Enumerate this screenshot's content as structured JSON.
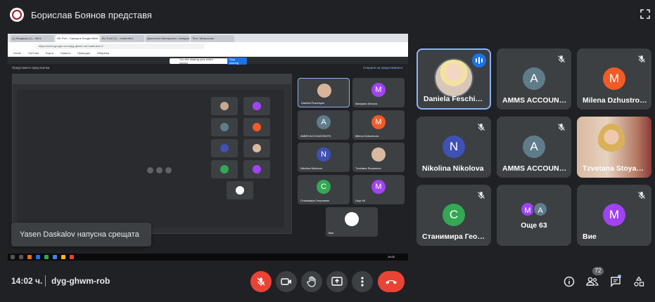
{
  "presenter": {
    "label": "Борислав Боянов представя"
  },
  "shared_screen": {
    "tabs": [
      "(1) Входящи (1) – bitrix",
      "GE Poll – Среща в Google Meet",
      "Bu.Trust (1) – email.bitrix",
      "Дигитални Материали | Instagram",
      "Тест: Шпаргалка"
    ],
    "url": "https://meet.google.com/dyg-ghwm-rob?authuser=2",
    "bookmarks": [
      "Gmail",
      "YouTube",
      "Карти",
      "Новини",
      "Преводач",
      "Wikipedia"
    ],
    "sharing_banner": "You are sharing your entire screen",
    "stop_label": "Stop sharing",
    "inner_header": "Представяте пред всички",
    "inner_header_right": "Спиране на представянето",
    "inner_tiles": [
      {
        "name": "Daniela Feschiyan",
        "initial": "",
        "color": "#d9b49a"
      },
      {
        "name": "Mariyana Dimova",
        "initial": "M",
        "color": "#a142f4"
      },
      {
        "name": "AMMS ACCOUNTANTS",
        "initial": "A",
        "color": "#5f7c8a"
      },
      {
        "name": "Milena Dzhustrova",
        "initial": "M",
        "color": "#f25a26"
      },
      {
        "name": "Nikolina Nikolova",
        "initial": "N",
        "color": "#3f51b5"
      },
      {
        "name": "Tzvetana Stoyanova",
        "initial": "",
        "color": "#d9b9a0"
      },
      {
        "name": "Станимира Георгиева",
        "initial": "C",
        "color": "#34a853"
      },
      {
        "name": "Още 64",
        "initial": "M",
        "color": "#a142f4"
      },
      {
        "name": "Вие",
        "initial": "",
        "color": "#ffffff"
      }
    ],
    "inner_btn_primary": "Спиране на представянето",
    "inner_btn_secondary": "Презентиране",
    "clock": "14:02"
  },
  "toast": {
    "text": "Yasen Daskalov напусна срещата"
  },
  "participants": [
    {
      "name": "Daniela Feschiyan",
      "initial": "",
      "color": "",
      "state": "speaking"
    },
    {
      "name": "AMMS ACCOUNTANTS",
      "initial": "A",
      "color": "#5f7c8a",
      "state": "muted"
    },
    {
      "name": "Milena Dzhustrova",
      "initial": "M",
      "color": "#f25a26",
      "state": "muted"
    },
    {
      "name": "Nikolina Nikolova",
      "initial": "N",
      "color": "#3f51b5",
      "state": "muted"
    },
    {
      "name": "AMMS ACCOUNTANTS",
      "initial": "A",
      "color": "#5f7c8a",
      "state": "muted"
    },
    {
      "name": "Tzvetana Stoyanova",
      "initial": "",
      "color": "",
      "state": "video"
    },
    {
      "name": "Станимира Георгиева",
      "initial": "C",
      "color": "#34a853",
      "state": "muted"
    },
    {
      "name": "Още 63",
      "initial": "M",
      "color": "#a142f4",
      "state": "more"
    },
    {
      "name": "Вие",
      "initial": "M",
      "color": "#a142f4",
      "state": "muted"
    }
  ],
  "more_avatars": [
    {
      "initial": "M",
      "color": "#a142f4"
    },
    {
      "initial": "A",
      "color": "#5f7c8a"
    }
  ],
  "bottom_bar": {
    "time": "14:02 ч.",
    "meeting_code": "dyg-ghwm-rob",
    "participants_count": "72"
  },
  "colors": {
    "background": "#202124",
    "tile": "#3c4043",
    "accent": "#8ab4f8",
    "danger": "#ea4335"
  }
}
